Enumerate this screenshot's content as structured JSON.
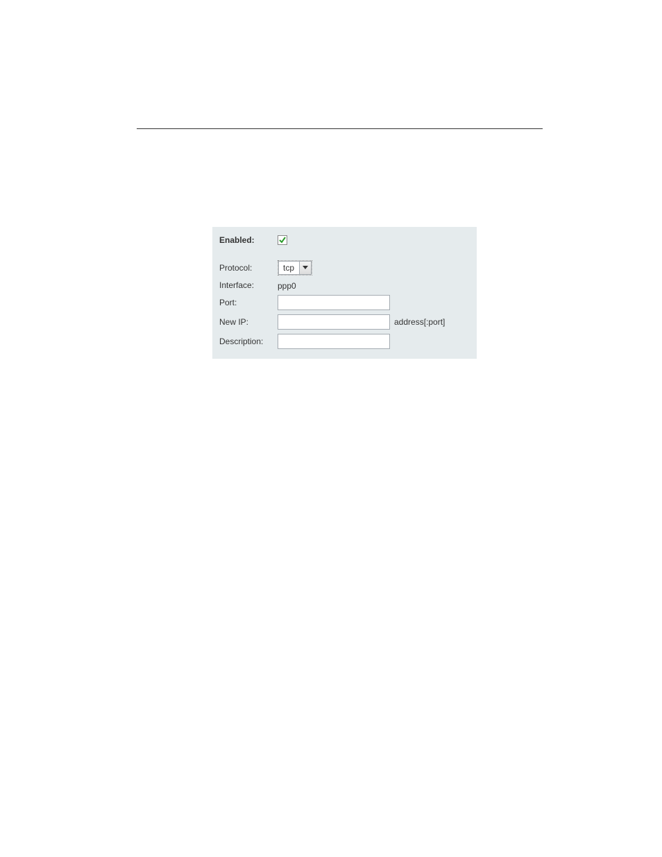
{
  "form": {
    "enabled_label": "Enabled:",
    "enabled_checked": true,
    "protocol_label": "Protocol:",
    "protocol_value": "tcp",
    "interface_label": "Interface:",
    "interface_value": "ppp0",
    "port_label": "Port:",
    "port_value": "",
    "newip_label": "New IP:",
    "newip_value": "",
    "newip_suffix": "address[:port]",
    "description_label": "Description:",
    "description_value": ""
  }
}
